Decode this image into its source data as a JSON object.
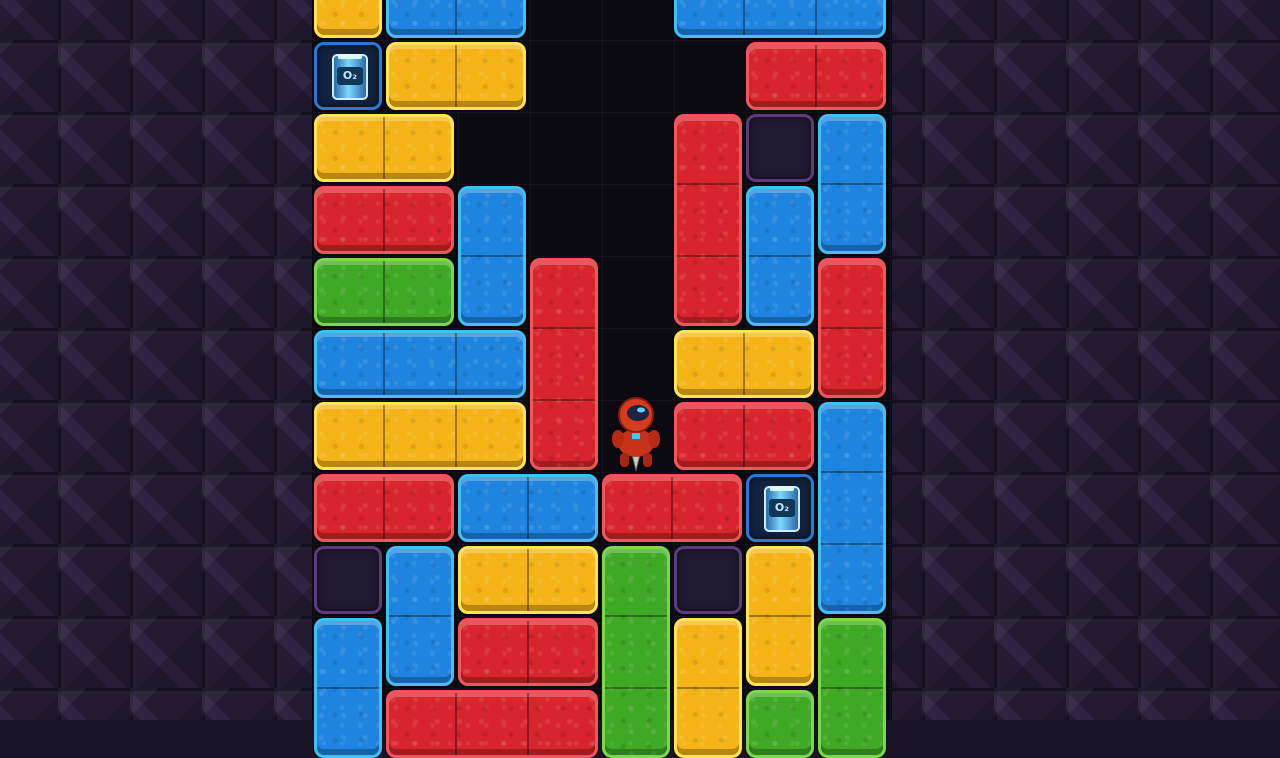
{
  "game": {
    "background_tile_color": "#241b33",
    "well_color": "#0b0a10"
  },
  "colors": {
    "red": "#d8242d",
    "blue": "#1f84e0",
    "yellow": "#f4b417",
    "green": "#3fa825",
    "empty_border": "#5a3b7a",
    "oxygen_border": "#2d78d6"
  },
  "oxygen_label": "O₂",
  "player": {
    "name": "driller",
    "suit_color": "#d23a1e"
  },
  "icons": [
    "oxygen-canister-icon",
    "driller-character-icon"
  ]
}
